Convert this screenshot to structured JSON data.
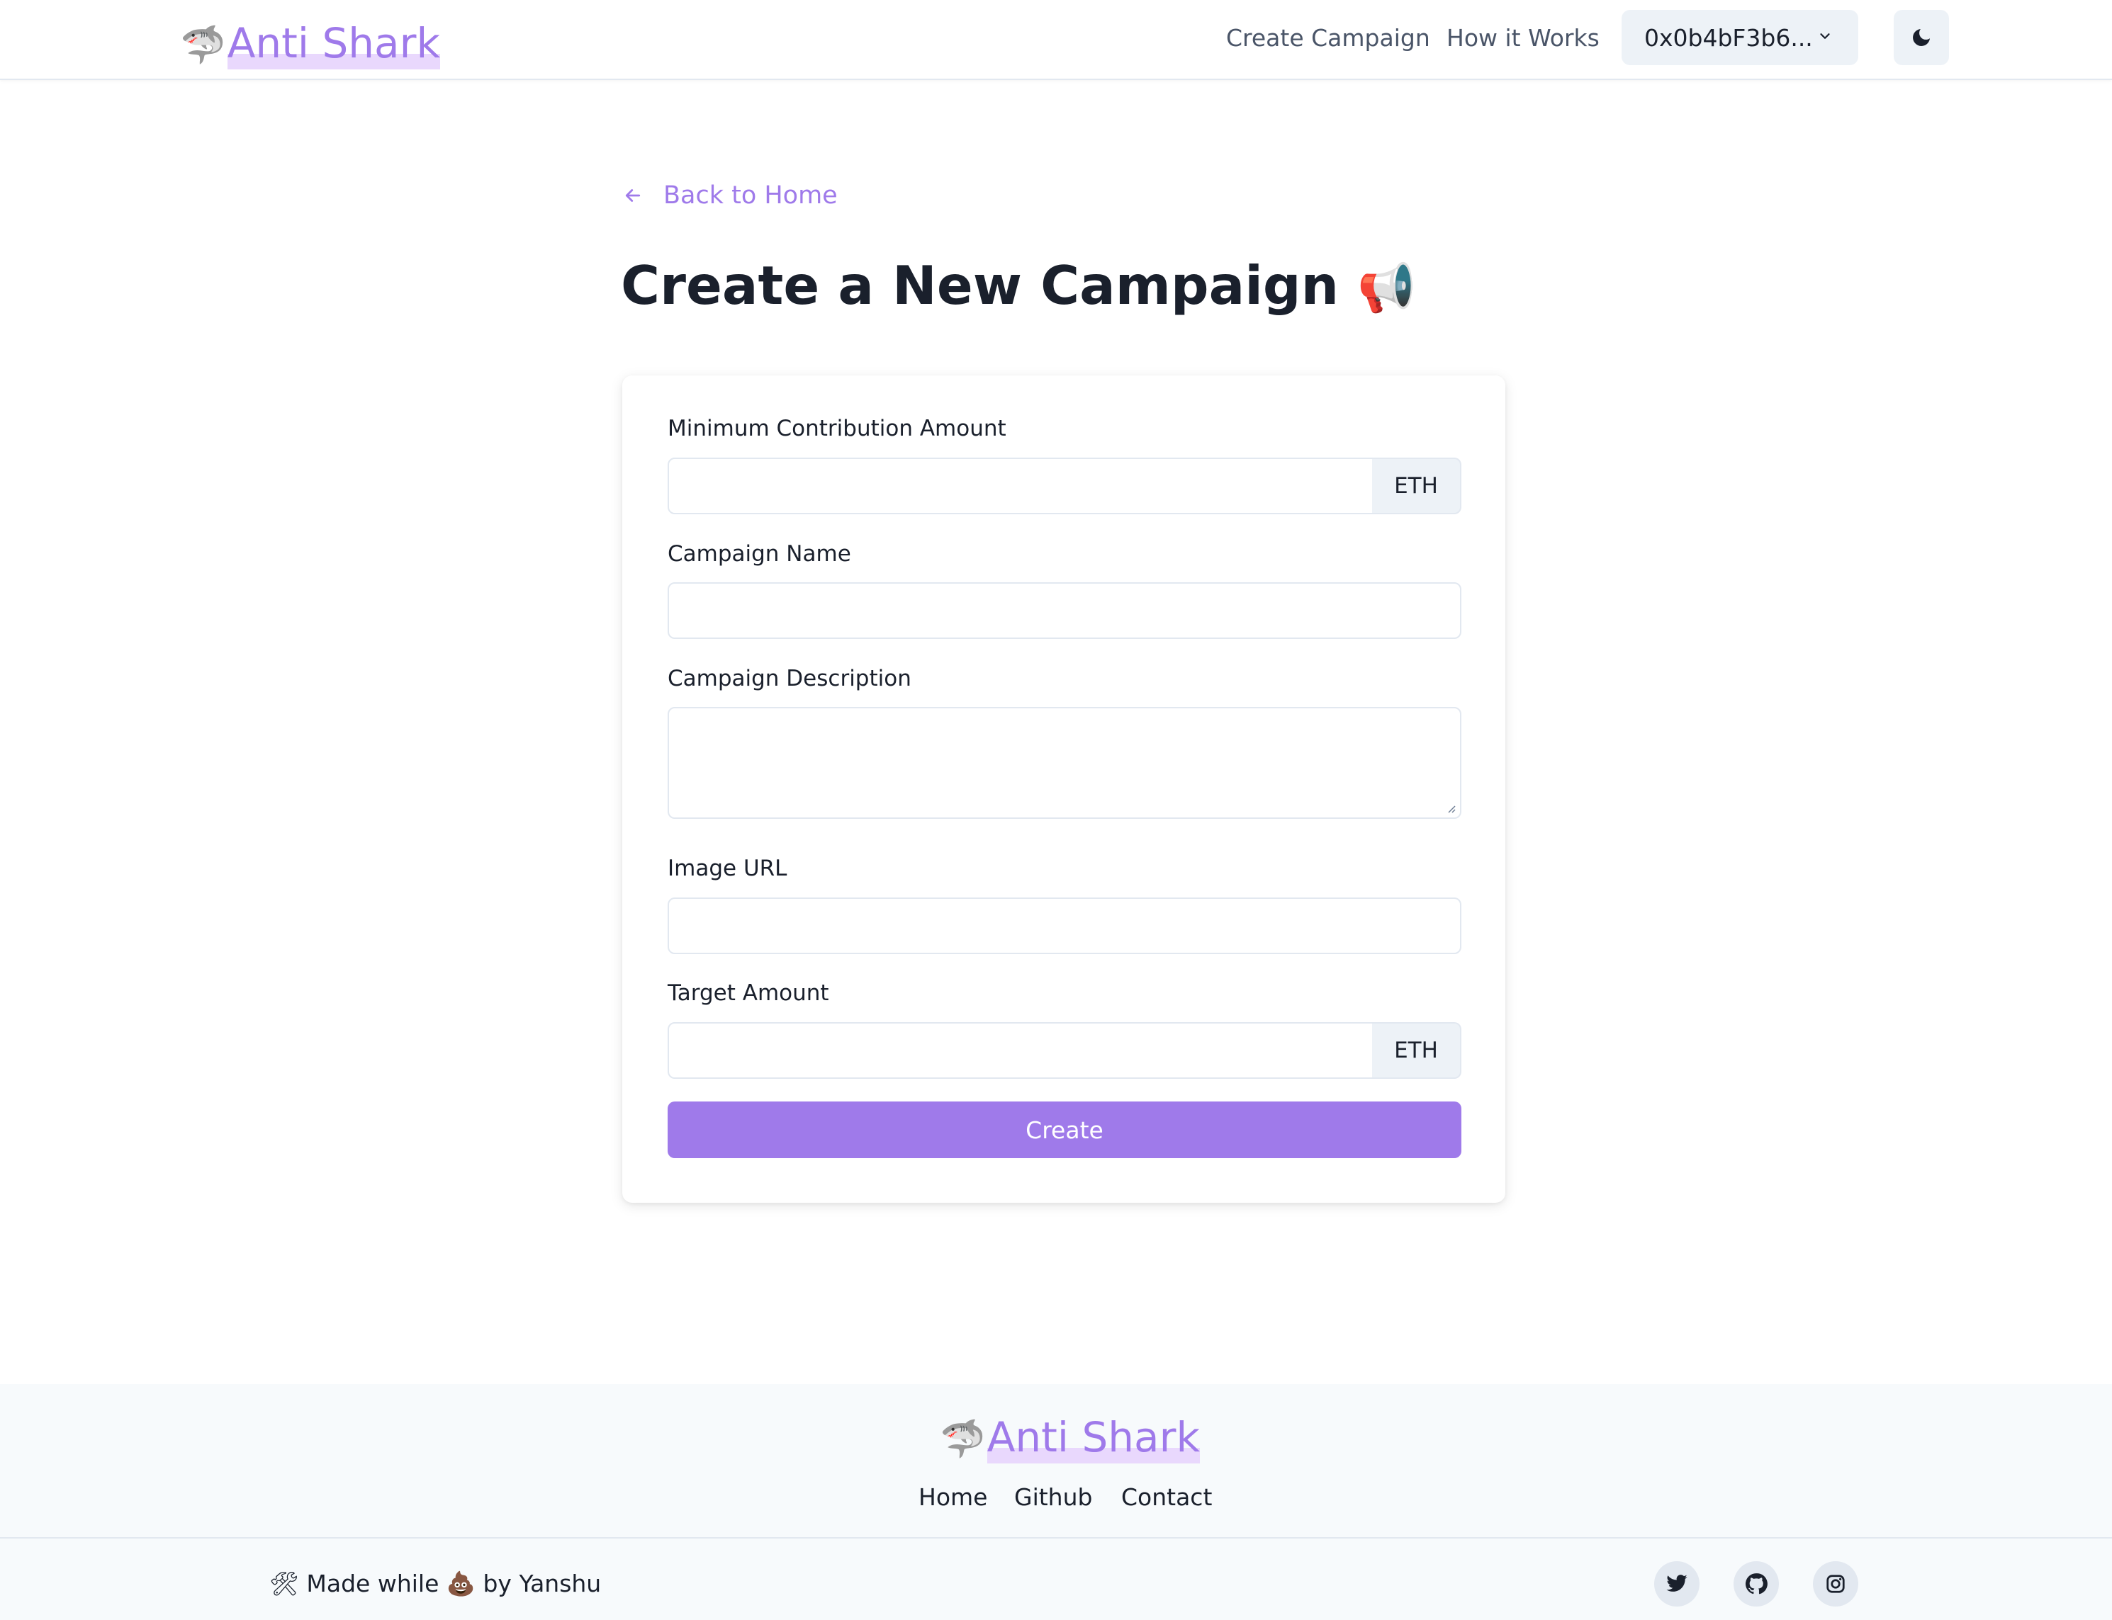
{
  "brand": {
    "emoji": "🦈",
    "name": "Anti Shark",
    "accent_color": "#9f7aea",
    "highlight_color": "#e9d8fd"
  },
  "nav": {
    "create_campaign": "Create Campaign",
    "how_it_works": "How it Works",
    "wallet_address": "0x0b4bF3b6...",
    "wallet_icon": "chevron-down-icon",
    "theme_icon": "moon-icon"
  },
  "main": {
    "back_label": "Back to Home",
    "back_icon": "arrow-left-icon",
    "title": "Create a New Campaign",
    "title_emoji": "📢"
  },
  "form": {
    "min_contribution": {
      "label": "Minimum Contribution Amount",
      "value": "",
      "addon": "ETH"
    },
    "campaign_name": {
      "label": "Campaign Name",
      "value": ""
    },
    "description": {
      "label": "Campaign Description",
      "value": ""
    },
    "image_url": {
      "label": "Image URL",
      "value": ""
    },
    "target_amount": {
      "label": "Target Amount",
      "value": "",
      "addon": "ETH"
    },
    "submit_label": "Create"
  },
  "footer": {
    "links": [
      "Home",
      "Github",
      "Contact"
    ],
    "made_prefix_emoji": "🛠",
    "made_text_1": "Made while",
    "made_emoji": "💩",
    "made_text_2": "by Yanshu",
    "social_icons": [
      "twitter-icon",
      "github-icon",
      "instagram-icon"
    ]
  }
}
